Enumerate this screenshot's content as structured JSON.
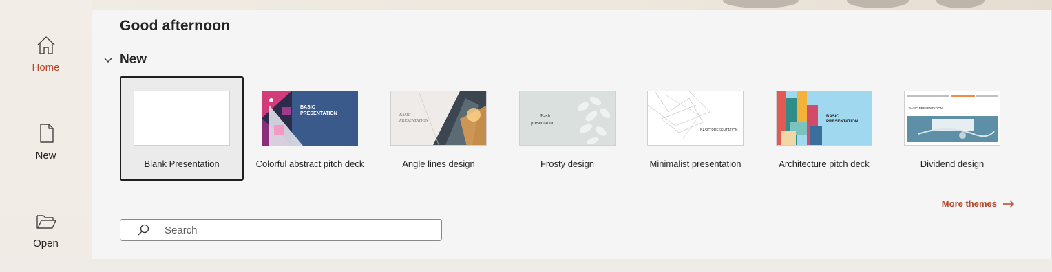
{
  "nav": {
    "items": [
      {
        "label": "Home",
        "icon": "home-icon",
        "active": true
      },
      {
        "label": "New",
        "icon": "new-document-icon",
        "active": false
      },
      {
        "label": "Open",
        "icon": "open-folder-icon",
        "active": false
      }
    ]
  },
  "main": {
    "greeting": "Good afternoon",
    "section_title": "New",
    "templates": [
      {
        "label": "Blank Presentation",
        "thumb_text": ""
      },
      {
        "label": "Colorful abstract pitch deck",
        "thumb_text": "BASIC PRESENTATION"
      },
      {
        "label": "Angle lines design",
        "thumb_text": "BASIC PRESENTATION"
      },
      {
        "label": "Frosty design",
        "thumb_text": "Basic presentation"
      },
      {
        "label": "Minimalist presentation",
        "thumb_text": "BASIC PRESENTATION"
      },
      {
        "label": "Architecture pitch deck",
        "thumb_text": "BASIC PRESENTATION"
      },
      {
        "label": "Dividend design",
        "thumb_text": "BASIC PRESENTATION"
      }
    ],
    "more_themes": "More themes",
    "search_placeholder": "Search"
  },
  "colors": {
    "accent": "#b7472a",
    "main_bg": "#f5f5f5",
    "nav_bg": "#f3ede7"
  }
}
